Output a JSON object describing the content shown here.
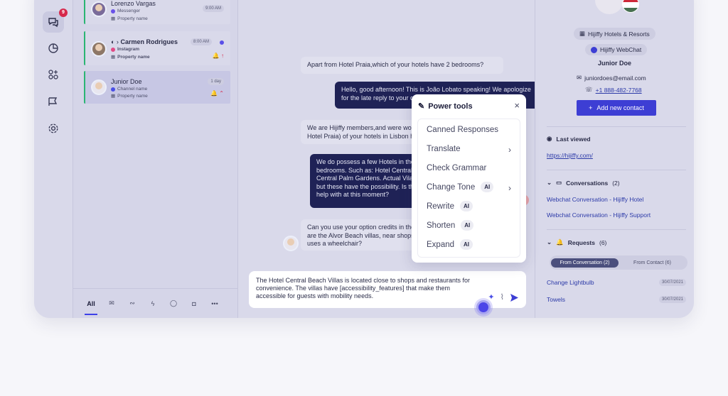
{
  "rail": {
    "badge": "9"
  },
  "conversations": [
    {
      "name": "Lorenzo Vargas",
      "channel": "Messenger",
      "property": "Property name",
      "time": "9:00 AM"
    },
    {
      "name": "Carmen Rodrigues",
      "channel": "Instagram",
      "property": "Property name",
      "time": "8:00 AM"
    },
    {
      "name": "Junior Doe",
      "channel": "Channel name",
      "property": "Property name",
      "time": "1 day"
    }
  ],
  "list_tabs": {
    "all": "All"
  },
  "messages": [
    {
      "dir": "in",
      "text": "Apart from Hotel Praia,which of your hotels have 2 bedrooms?"
    },
    {
      "dir": "out",
      "text": "Hello, good afternoon! This is João Lobato speaking! We apologize for the late reply to your question."
    },
    {
      "dir": "in",
      "text": "We are Hijiffy members,and were wondering it Hotel Praia) of your hotels in Lisbon have 2 b"
    },
    {
      "dir": "out",
      "text": "We do possess a few Hotels in the area offe bedrooms. Such as: Hotel Central Beach Vill Central Palm Gardens. Actual Vila/Room ava but these have the possibility. Is there anyth to help with at this moment?"
    },
    {
      "dir": "in",
      "text": "Can you use your option credits in the Hotel C are the Alvor Beach villas, near shops/restaura uses a wheelchair?"
    }
  ],
  "composer": {
    "text": "The Hotel Central Beach Villas is located close to shops and restaurants for convenience. The villas have [accessibility_features] that make them accessible for guests with mobility needs."
  },
  "power_tools": {
    "title": "Power tools",
    "close": "×",
    "ai_label": "AI",
    "items": [
      {
        "label": "Canned Responses"
      },
      {
        "label": "Translate"
      },
      {
        "label": "Check Grammar"
      },
      {
        "label": "Change Tone"
      },
      {
        "label": "Rewrite"
      },
      {
        "label": "Shorten"
      },
      {
        "label": "Expand"
      }
    ]
  },
  "contact": {
    "org": "Hijiffy Hotels & Resorts",
    "channel": "Hijiffy WebChat",
    "name": "Junior Doe",
    "email": "juniordoes@email.com",
    "phone": "+1 888-482-7768",
    "add_button": "Add new contact"
  },
  "last_viewed": {
    "title": "Last viewed",
    "url": "https://hijiffy.com/"
  },
  "conversations_section": {
    "title": "Conversations",
    "count": "(2)",
    "items": [
      "Webchat Conversation - Hijiffy Hotel",
      "Webchat Conversation - Hijiffy Support"
    ]
  },
  "requests": {
    "title": "Requests",
    "count": "(6)",
    "tab_from_conversation": "From Conversation (2)",
    "tab_from_contact": "From Contact (6)",
    "items": [
      {
        "label": "Change Lightbulb",
        "date": "30/07/2021"
      },
      {
        "label": "Towels",
        "date": "30/07/2021"
      }
    ]
  },
  "colors": {
    "accent": "#3d3ed4",
    "active_bar": "#2bb573",
    "dark_bubble": "#1f2256"
  }
}
